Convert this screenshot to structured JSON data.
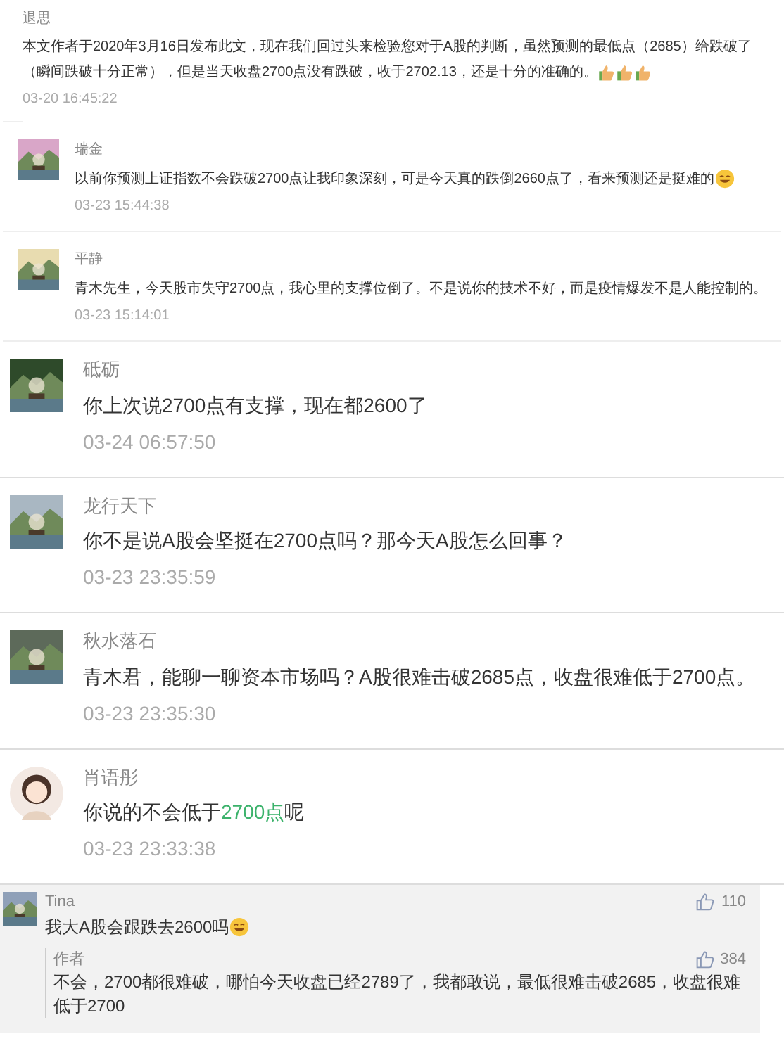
{
  "article_note": {
    "author": "退思",
    "text": "本文作者于2020年3月16日发布此文，现在我们回过头来检验您对于A股的判断，虽然预测的最低点（2685）给跌破了（瞬间跌破十分正常），但是当天收盘2700点没有跌破，收于2702.13，还是十分的准确的。",
    "emoji": [
      {
        "kind": "thumbs-up"
      },
      {
        "kind": "thumbs-up"
      },
      {
        "kind": "thumbs-up"
      }
    ],
    "time": "03-20 16:45:22"
  },
  "comments": [
    {
      "kind": "small",
      "name": "瑞金",
      "parts": [
        {
          "text": "以前你预测上证指数不会跌破2700点让我印象深刻，可是今天真的跌倒2660点了，看来预测还是挺难的",
          "highlight": false
        }
      ],
      "emoji": [
        {
          "kind": "smiley"
        }
      ],
      "time": "03-23 15:44:38"
    },
    {
      "kind": "small",
      "name": "平静",
      "parts": [
        {
          "text": "青木先生，今天股市失守2700点，我心里的支撑位倒了。不是说你的技术不好，而是疫情爆发不是人能控制的。",
          "highlight": false
        }
      ],
      "time": "03-23 15:14:01"
    },
    {
      "kind": "large",
      "name": "砥砺",
      "parts": [
        {
          "text": "你上次说2700点有支撑，现在都2600了",
          "highlight": false
        }
      ],
      "time": "03-24 06:57:50"
    },
    {
      "kind": "large",
      "name": "龙行天下",
      "parts": [
        {
          "text": "你不是说A股会坚挺在2700点吗？那今天A股怎么回事？",
          "highlight": false
        }
      ],
      "time": "03-23 23:35:59"
    },
    {
      "kind": "large",
      "name": "秋水落石",
      "parts": [
        {
          "text": "青木君，能聊一聊资本市场吗？A股很难击破2685点，收盘很难低于2700点。",
          "highlight": false
        }
      ],
      "time": "03-23 23:35:30"
    },
    {
      "kind": "large",
      "name": "肖语彤",
      "parts": [
        {
          "text": "你说的不会低于",
          "highlight": false
        },
        {
          "text": "2700点",
          "highlight": true
        },
        {
          "text": "呢",
          "highlight": false
        }
      ],
      "time": "03-23 23:33:38"
    }
  ],
  "thread": {
    "name": "Tina",
    "text": "我大A股会跟跌去2600吗",
    "emoji": [
      {
        "kind": "smiley"
      }
    ],
    "likes": "110",
    "reply": {
      "name": "作者",
      "text": "不会，2700都很难破，哪怕今天收盘已经2789了，我都敢说，最低很难击破2685，收盘很难低于2700",
      "likes": "384"
    }
  }
}
